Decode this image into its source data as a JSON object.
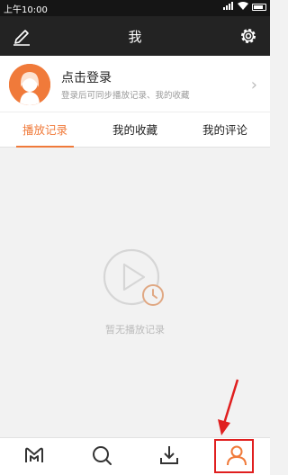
{
  "status": {
    "time": "上午10:00"
  },
  "header": {
    "title": "我",
    "edit_icon": "edit-icon",
    "settings_icon": "gear-icon"
  },
  "profile": {
    "title": "点击登录",
    "subtitle": "登录后可同步播放记录、我的收藏",
    "arrow": "›"
  },
  "tabs": [
    {
      "label": "播放记录",
      "active": true
    },
    {
      "label": "我的收藏",
      "active": false
    },
    {
      "label": "我的评论",
      "active": false
    }
  ],
  "empty": {
    "text": "暂无播放记录",
    "icon": "play-history-icon"
  },
  "bottom_nav": [
    {
      "icon": "logo-home-icon"
    },
    {
      "icon": "search-icon"
    },
    {
      "icon": "download-icon"
    },
    {
      "icon": "user-icon",
      "active": true
    }
  ],
  "colors": {
    "accent": "#f07a3a",
    "header_bg": "#232323",
    "annotation": "#e01f1f"
  }
}
